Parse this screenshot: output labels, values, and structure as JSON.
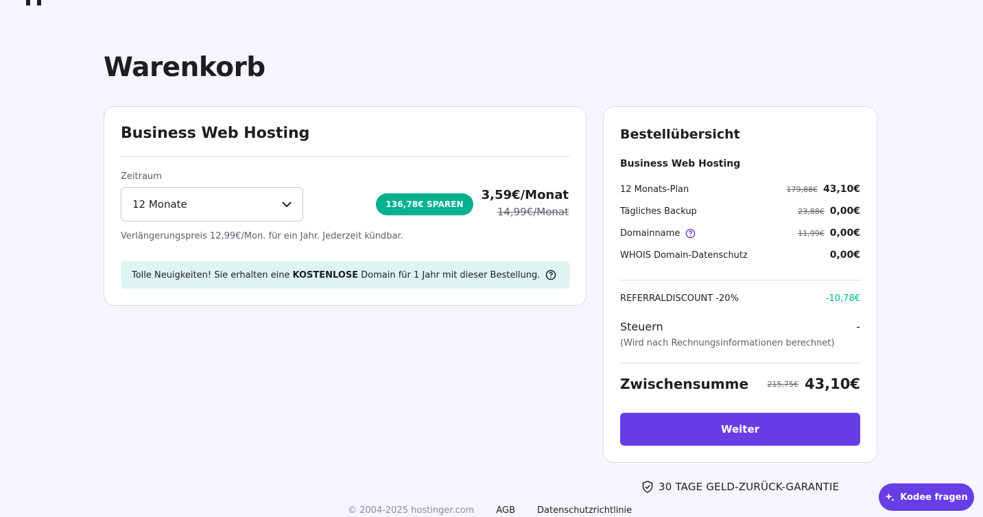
{
  "header": {
    "title": "Warenkorb"
  },
  "cart": {
    "product_title": "Business Web Hosting",
    "period_label": "Zeitraum",
    "period_value": "12 Monate",
    "save_badge": "136,78€ SPAREN",
    "price_now": "3,59€/Monat",
    "price_old": "14,99€/Monat",
    "renewal": "Verlängerungspreis 12,99€/Mon. für ein Jahr. Jederzeit kündbar.",
    "banner": {
      "before": "Tolle Neuigkeiten! Sie erhalten eine",
      "bold": "KOSTENLOSE",
      "after": "Domain für 1 Jahr mit dieser Bestellung."
    }
  },
  "summary": {
    "title": "Bestellübersicht",
    "product": "Business Web Hosting",
    "items": [
      {
        "label": "12 Monats-Plan",
        "old": "179,88€",
        "now": "43,10€"
      },
      {
        "label": "Tägliches Backup",
        "old": "23,88€",
        "now": "0,00€"
      },
      {
        "label": "Domainname",
        "old": "11,99€",
        "now": "0,00€"
      },
      {
        "label": "WHOIS Domain-Datenschutz",
        "old": "",
        "now": "0,00€"
      }
    ],
    "discount_label": "REFERRALDISCOUNT -20%",
    "discount_value": "-10,78€",
    "tax_label": "Steuern",
    "tax_value": "-",
    "tax_note": "(Wird nach Rechnungsinformationen berechnet)",
    "subtotal_label": "Zwischensumme",
    "subtotal_old": "215,75€",
    "subtotal_now": "43,10€",
    "continue_label": "Weiter"
  },
  "guarantee": "30 TAGE GELD-ZURÜCK-GARANTIE",
  "footer": {
    "copyright": "© 2004-2025 hostinger.com",
    "links": [
      "AGB",
      "Datenschutzrichtlinie"
    ]
  },
  "assistant": {
    "label": "Kodee fragen"
  },
  "colors": {
    "accent": "#673de6",
    "success": "#00b090",
    "banner_bg": "#def4f0",
    "page_bg": "#f4f5ff"
  }
}
